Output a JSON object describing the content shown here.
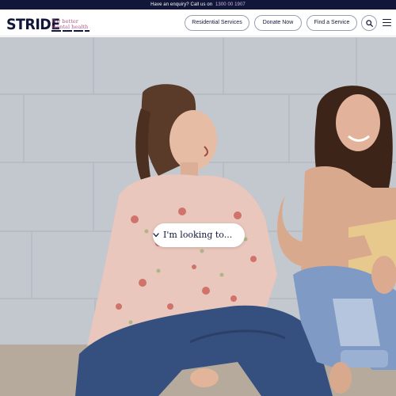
{
  "topbar": {
    "text": "Have an enquiry? Call us on",
    "phone": "1300 00 1907"
  },
  "brand": {
    "name": "STRIDE",
    "tagline_line1": "For better",
    "tagline_line2": "mental health",
    "accent_color": "#b05a86",
    "navy_color": "#121638"
  },
  "nav": {
    "residential": "Residential Services",
    "donate": "Donate Now",
    "find": "Find a Service",
    "search_icon": "search-icon",
    "menu_icon": "hamburger-menu-icon"
  },
  "hero": {
    "image": "two-smiling-women-sitting-against-wall",
    "selector_label": "I'm looking to..."
  }
}
